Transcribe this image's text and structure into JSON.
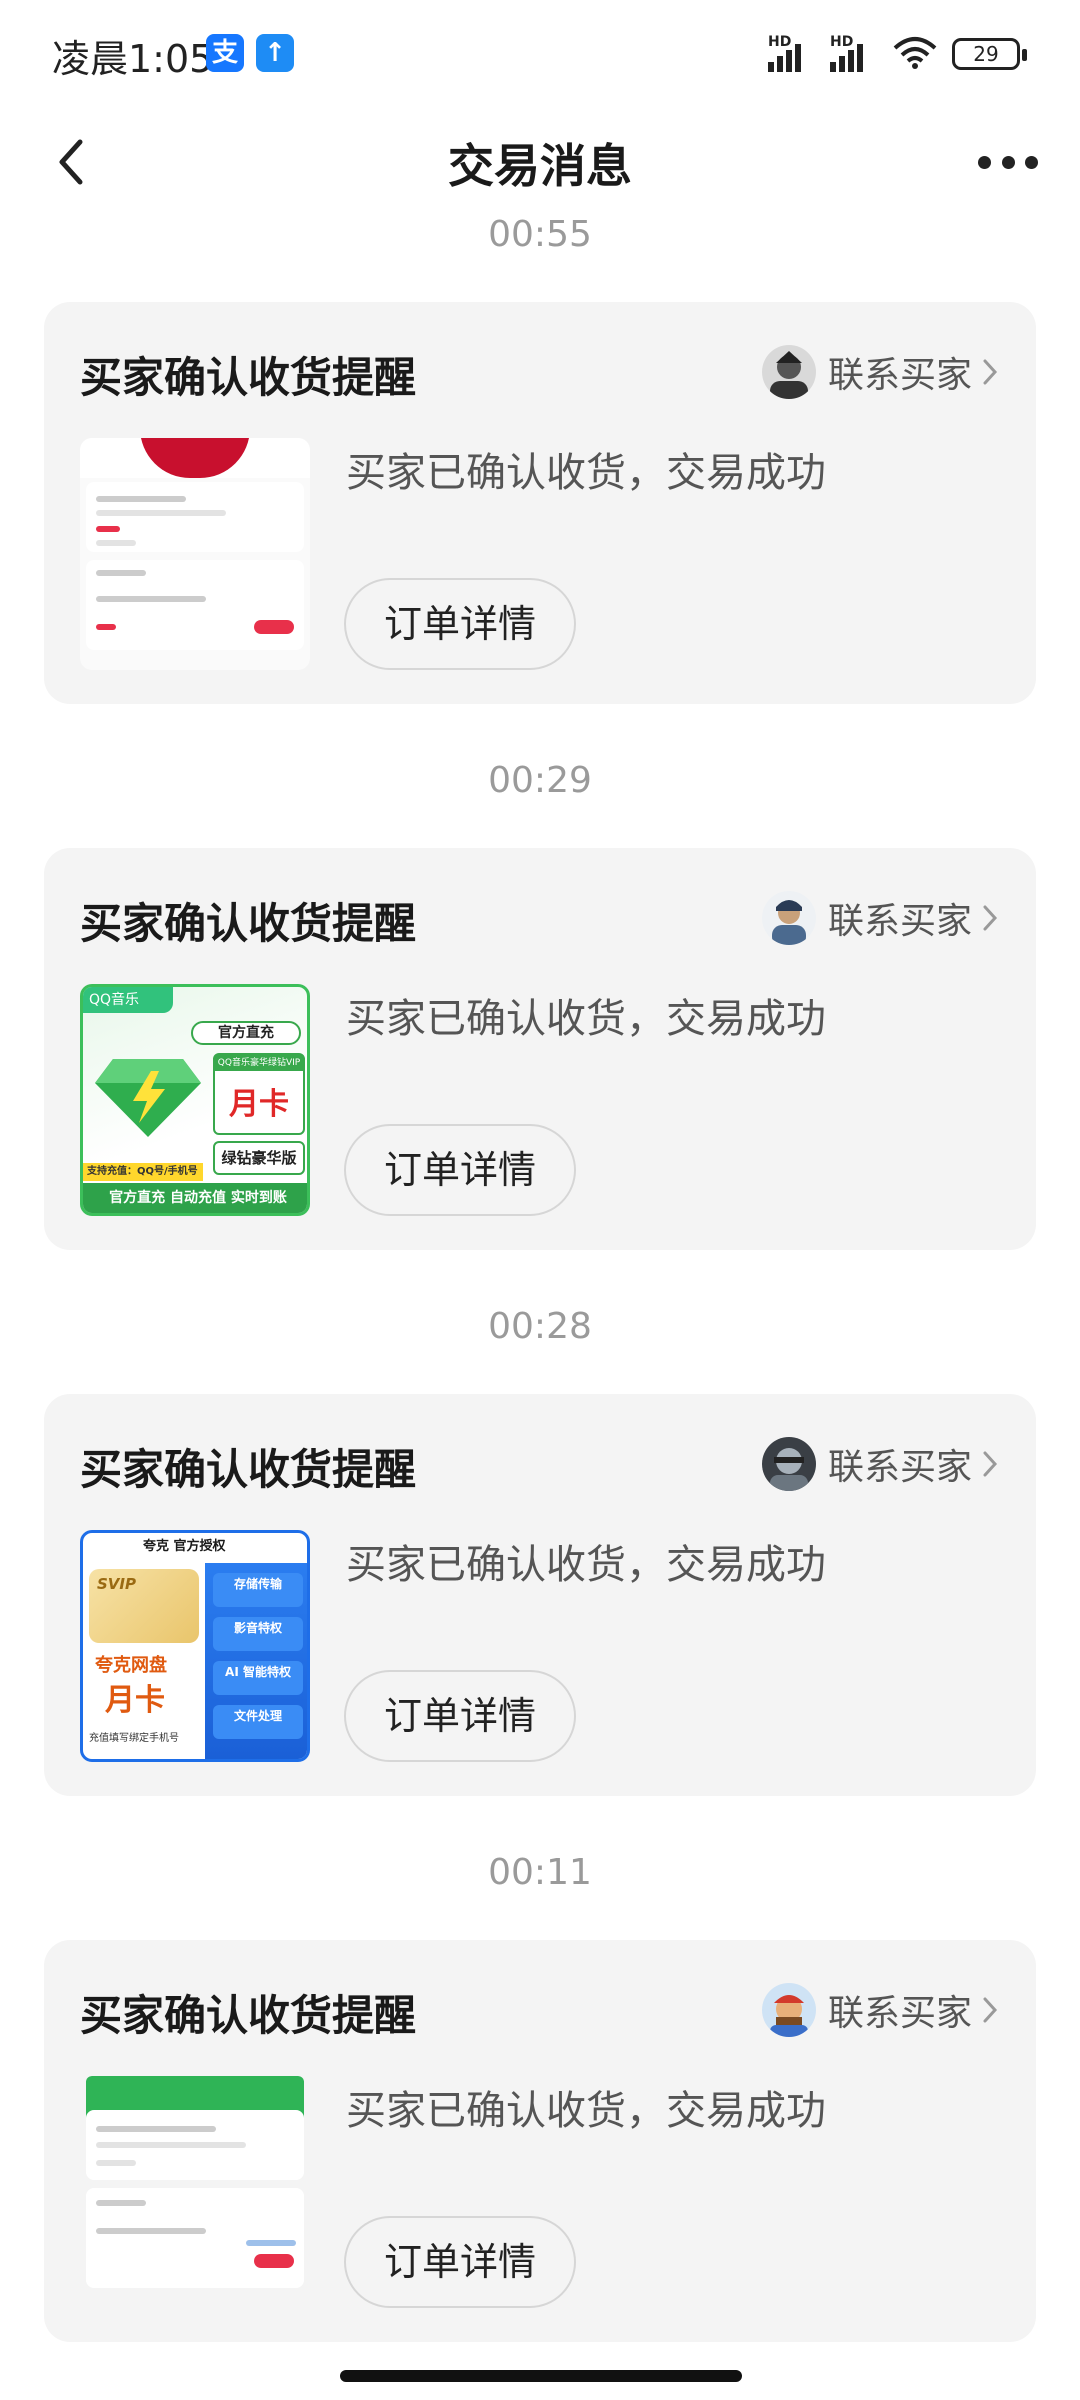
{
  "status_bar": {
    "time": "凌晨1:05",
    "app_icons": [
      "alipay-icon",
      "upload-icon"
    ],
    "signal1_label": "HD",
    "signal2_label": "HD",
    "battery": "29"
  },
  "nav": {
    "title": "交易消息",
    "back_icon": "chevron-left-icon",
    "more_icon": "more-horizontal-icon"
  },
  "messages": [
    {
      "time": "00:55",
      "title": "买家确认收货提醒",
      "contact_label": "联系买家",
      "status": "买家已确认收货，交易成功",
      "button": "订单详情",
      "thumb": "kfc-gift-card"
    },
    {
      "time": "00:29",
      "title": "买家确认收货提醒",
      "contact_label": "联系买家",
      "status": "买家已确认收货，交易成功",
      "button": "订单详情",
      "thumb": "qq-music-vip",
      "thumb_text": {
        "brand": "QQ音乐",
        "tag": "官方直充",
        "box_header": "QQ音乐豪华绿钻VIP",
        "box_big": "月卡",
        "version": "绿钻豪华版",
        "note": "支持充值：QQ号/手机号",
        "footer": "官方直充 自动充值 实时到账"
      }
    },
    {
      "time": "00:28",
      "title": "买家确认收货提醒",
      "contact_label": "联系买家",
      "status": "买家已确认收货，交易成功",
      "button": "订单详情",
      "thumb": "quark-svip",
      "thumb_text": {
        "brand": "夸克 官方授权",
        "svip": "SVIP",
        "line1": "夸克网盘",
        "line2": "月卡",
        "opts": [
          "存储传输",
          "影音特权",
          "AI 智能特权",
          "文件处理"
        ],
        "tip": "充值填写绑定手机号"
      }
    },
    {
      "time": "00:11",
      "title": "买家确认收货提醒",
      "contact_label": "联系买家",
      "status": "买家已确认收货，交易成功",
      "button": "订单详情",
      "thumb": "iqiyi-vip"
    }
  ]
}
